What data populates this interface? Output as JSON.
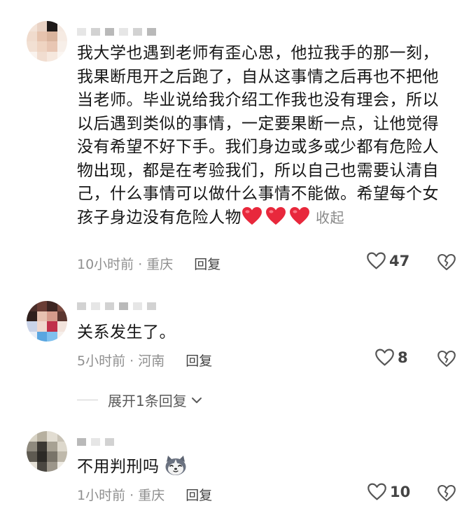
{
  "comments": [
    {
      "text": "我大学也遇到老师有歪心思，他拉我手的那一刻，我果断甩开之后跑了，自从这事情之后再也不把他当老师。毕业说给我介绍工作我也没有理会，所以以后遇到类似的事情，一定要果断一点，让他觉得没有希望不好下手。我们身边或多或少都有危险人物出现，都是在考验我们，所以自己也需要认清自己，什么事情可以做什么事情不能做。希望每个女孩子身边没有危险人物",
      "emoji_icon": "red-heart-emoji",
      "collapse_label": "收起",
      "time_location": "10小时前 · 重庆",
      "reply_label": "回复",
      "likes": "47"
    },
    {
      "text": "关系发生了。",
      "time_location": "5小时前 · 河南",
      "reply_label": "回复",
      "likes": "8"
    },
    {
      "text": "不用判刑吗",
      "emoji_icon": "husky-dog-emoji",
      "time_location": "1小时前 · 重庆",
      "reply_label": "回复",
      "likes": "10"
    }
  ],
  "expand_replies_label": "展开1条回复",
  "colors": {
    "text": "#161616",
    "meta": "#8f8f8f",
    "heart": "#e8283c"
  }
}
